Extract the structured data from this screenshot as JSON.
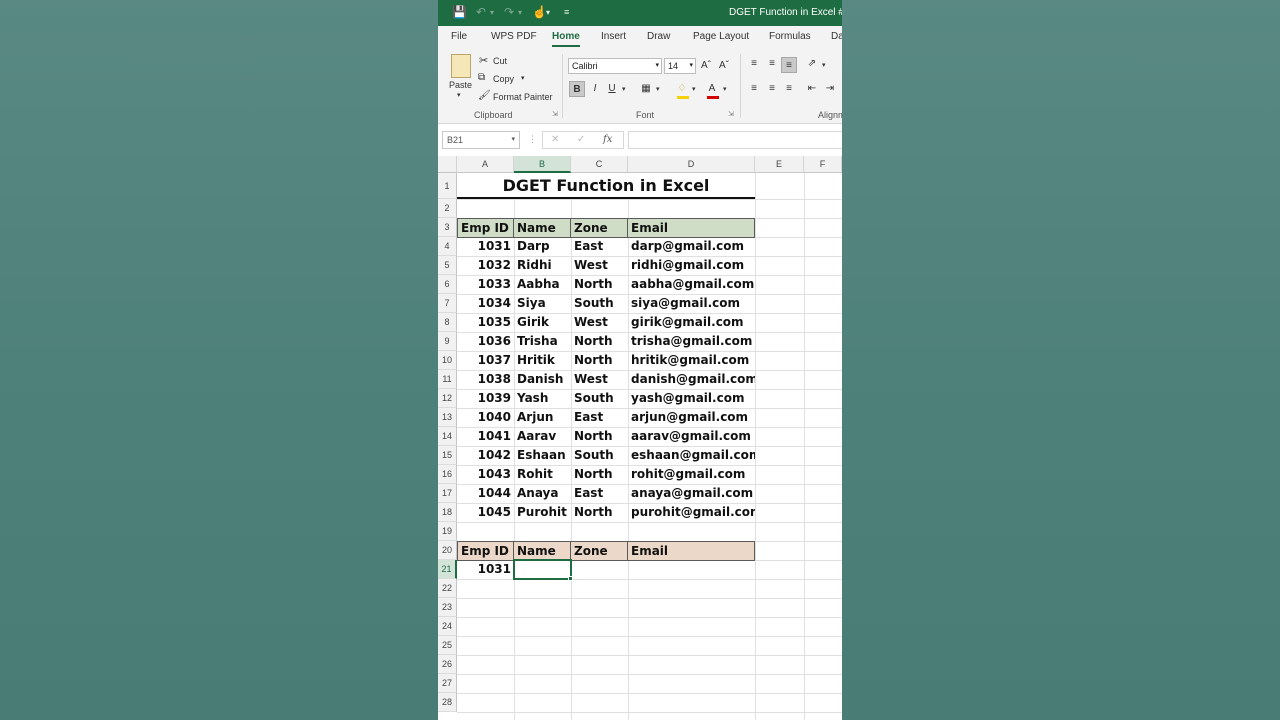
{
  "window": {
    "title": "DGET Function in Excel #exce"
  },
  "tabs": [
    "File",
    "WPS PDF",
    "Home",
    "Insert",
    "Draw",
    "Page Layout",
    "Formulas",
    "Da"
  ],
  "active_tab": "Home",
  "ribbon": {
    "paste_label": "Paste",
    "cut_label": "Cut",
    "copy_label": "Copy",
    "format_painter_label": "Format Painter",
    "clipboard_group": "Clipboard",
    "font_name": "Calibri",
    "font_size": "14",
    "font_group": "Font",
    "alignment_group": "Alignm",
    "bold_label": "B",
    "italic_label": "I",
    "underline_label": "U"
  },
  "formula_bar": {
    "name_box": "B21",
    "fx_label": "fx",
    "formula": ""
  },
  "columns": [
    "A",
    "B",
    "C",
    "D",
    "E",
    "F"
  ],
  "rows": [
    "1",
    "2",
    "3",
    "4",
    "5",
    "6",
    "7",
    "8",
    "9",
    "10",
    "11",
    "12",
    "13",
    "14",
    "15",
    "16",
    "17",
    "18",
    "19",
    "20",
    "21",
    "22",
    "23",
    "24",
    "25",
    "26",
    "27",
    "28"
  ],
  "sheet": {
    "title": "DGET Function in Excel",
    "headers": [
      "Emp ID",
      "Name",
      "Zone",
      "Email"
    ],
    "records": [
      [
        "1031",
        "Darp",
        "East",
        "darp@gmail.com"
      ],
      [
        "1032",
        "Ridhi",
        "West",
        "ridhi@gmail.com"
      ],
      [
        "1033",
        "Aabha",
        "North",
        "aabha@gmail.com"
      ],
      [
        "1034",
        "Siya",
        "South",
        "siya@gmail.com"
      ],
      [
        "1035",
        "Girik",
        "West",
        "girik@gmail.com"
      ],
      [
        "1036",
        "Trisha",
        "North",
        "trisha@gmail.com"
      ],
      [
        "1037",
        "Hritik",
        "North",
        "hritik@gmail.com"
      ],
      [
        "1038",
        "Danish",
        "West",
        "danish@gmail.com"
      ],
      [
        "1039",
        "Yash",
        "South",
        "yash@gmail.com"
      ],
      [
        "1040",
        "Arjun",
        "East",
        "arjun@gmail.com"
      ],
      [
        "1041",
        "Aarav",
        "North",
        "aarav@gmail.com"
      ],
      [
        "1042",
        "Eshaan",
        "South",
        "eshaan@gmail.com"
      ],
      [
        "1043",
        "Rohit",
        "North",
        "rohit@gmail.com"
      ],
      [
        "1044",
        "Anaya",
        "East",
        "anaya@gmail.com"
      ],
      [
        "1045",
        "Purohit",
        "North",
        "purohit@gmail.com"
      ]
    ],
    "lookup_headers": [
      "Emp ID",
      "Name",
      "Zone",
      "Email"
    ],
    "lookup_value": "1031"
  },
  "colors": {
    "accent": "#1e6c41",
    "header_fill": "#cfdcc6",
    "lookup_header_fill": "#ecd8c8",
    "backdrop": "#4d7f79"
  }
}
